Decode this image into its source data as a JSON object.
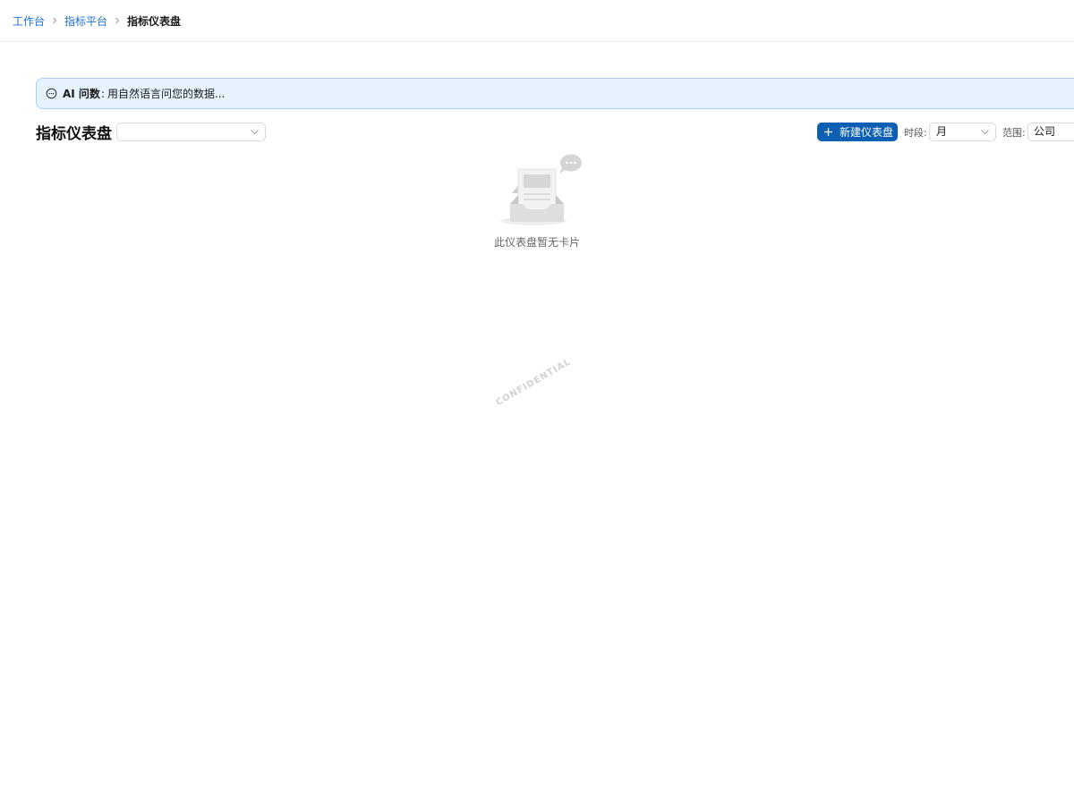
{
  "breadcrumb": {
    "items": [
      "工作台",
      "指标平台"
    ],
    "current": "指标仪表盘"
  },
  "ai_bar": {
    "label": "AI 问数",
    "separator": ":",
    "placeholder": "用自然语言问您的数据..."
  },
  "header": {
    "title": "指标仪表盘",
    "dashboard_select_value": "",
    "new_button_label": "新建仪表盘",
    "period_label": "时段:",
    "period_value": "月",
    "scope_label": "范围:",
    "scope_value": "公司"
  },
  "empty_state": {
    "message": "此仪表盘暂无卡片"
  },
  "watermark": "CONFIDENTIAL",
  "colors": {
    "accent": "#0d5fb3",
    "link": "#1b6fd1",
    "ai_bar_bg": "#e6f2fd",
    "ai_bar_border": "#a9cff2"
  },
  "icons": [
    "chevron-right-icon",
    "chat-bubble-icon",
    "plus-icon",
    "chevron-down-icon",
    "empty-inbox-icon"
  ]
}
